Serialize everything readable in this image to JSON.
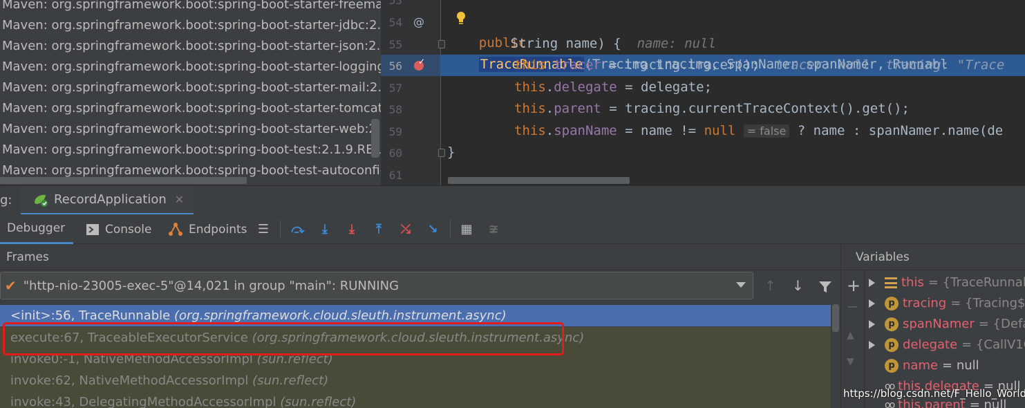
{
  "libraries": [
    "Maven: org.springframework.boot:spring-boot-starter-freemark",
    "Maven: org.springframework.boot:spring-boot-starter-jdbc:2.1.",
    "Maven: org.springframework.boot:spring-boot-starter-json:2.1.",
    "Maven: org.springframework.boot:spring-boot-starter-logging:2",
    "Maven: org.springframework.boot:spring-boot-starter-mail:2.1.",
    "Maven: org.springframework.boot:spring-boot-starter-tomcat:2",
    "Maven: org.springframework.boot:spring-boot-starter-web:2.1.",
    "Maven: org.springframework.boot:spring-boot-test:2.1.9.RELEAS",
    "Maven: org.springframework.boot:spring-boot-test-autoconfigu"
  ],
  "editor": {
    "line_numbers": [
      "53",
      "54",
      "55",
      "56",
      "57",
      "58",
      "59",
      "60",
      "61"
    ],
    "at_marker": "@",
    "code": {
      "l54_kw": "public",
      "l54_ctor": "TraceRunnable",
      "l54_rest": "(Tracing tracing, SpanNamer spanNamer, Runnabl",
      "l55_text": "        String name) {",
      "l55_hint": "name: null",
      "l56_this": "this",
      "l56_field": "tracer",
      "l56_rest": " = tracing.tracer();",
      "l56_hint": "tracer: null  tracing: \"Trace",
      "l57_this": "this",
      "l57_field": "delegate",
      "l57_rest": " = delegate;",
      "l58_this": "this",
      "l58_field": "parent",
      "l58_rest": " = tracing.currentTraceContext().get();",
      "l59_this": "this",
      "l59_field": "spanName",
      "l59_mid": " = name != ",
      "l59_null": "null",
      "l59_inlay": "= false",
      "l59_rest": " ? name : spanNamer.name(de",
      "l60_text": "}"
    }
  },
  "debug": {
    "label": "g:",
    "run_config_tab": "RecordApplication",
    "tabs": {
      "debugger": "Debugger",
      "console": "Console",
      "endpoints": "Endpoints"
    },
    "frames": {
      "header": "Frames",
      "thread": "\"http-nio-23005-exec-5\"@14,021 in group \"main\": RUNNING",
      "items": [
        {
          "method": "<init>:56, TraceRunnable",
          "pkg": "(org.springframework.cloud.sleuth.instrument.async)"
        },
        {
          "method": "execute:67, TraceableExecutorService",
          "pkg": "(org.springframework.cloud.sleuth.instrument.async)"
        },
        {
          "method": "invoke0:-1, NativeMethodAccessorImpl",
          "pkg": "(sun.reflect)"
        },
        {
          "method": "invoke:62, NativeMethodAccessorImpl",
          "pkg": "(sun.reflect)"
        },
        {
          "method": "invoke:43, DelegatingMethodAccessorImpl",
          "pkg": "(sun.reflect)"
        }
      ]
    },
    "variables": {
      "header": "Variables",
      "items": [
        {
          "name": "this",
          "value": "= {TraceRunnab"
        },
        {
          "name": "tracing",
          "value": "= {Tracing$I"
        },
        {
          "name": "spanNamer",
          "value": "= {Defa"
        },
        {
          "name": "delegate",
          "value": "= {CallV1C"
        },
        {
          "name": "name",
          "value": "= null"
        },
        {
          "name": "this.delegate",
          "value": "= null"
        },
        {
          "name": "this.parent",
          "value": "= null"
        }
      ]
    }
  },
  "watermark": "https://blog.csdn.net/F_Hello_World",
  "colors": {
    "highlight_line": "#2d5a92",
    "selected_frame": "#4b6eaf",
    "annotation_box": "#e31b1b"
  }
}
